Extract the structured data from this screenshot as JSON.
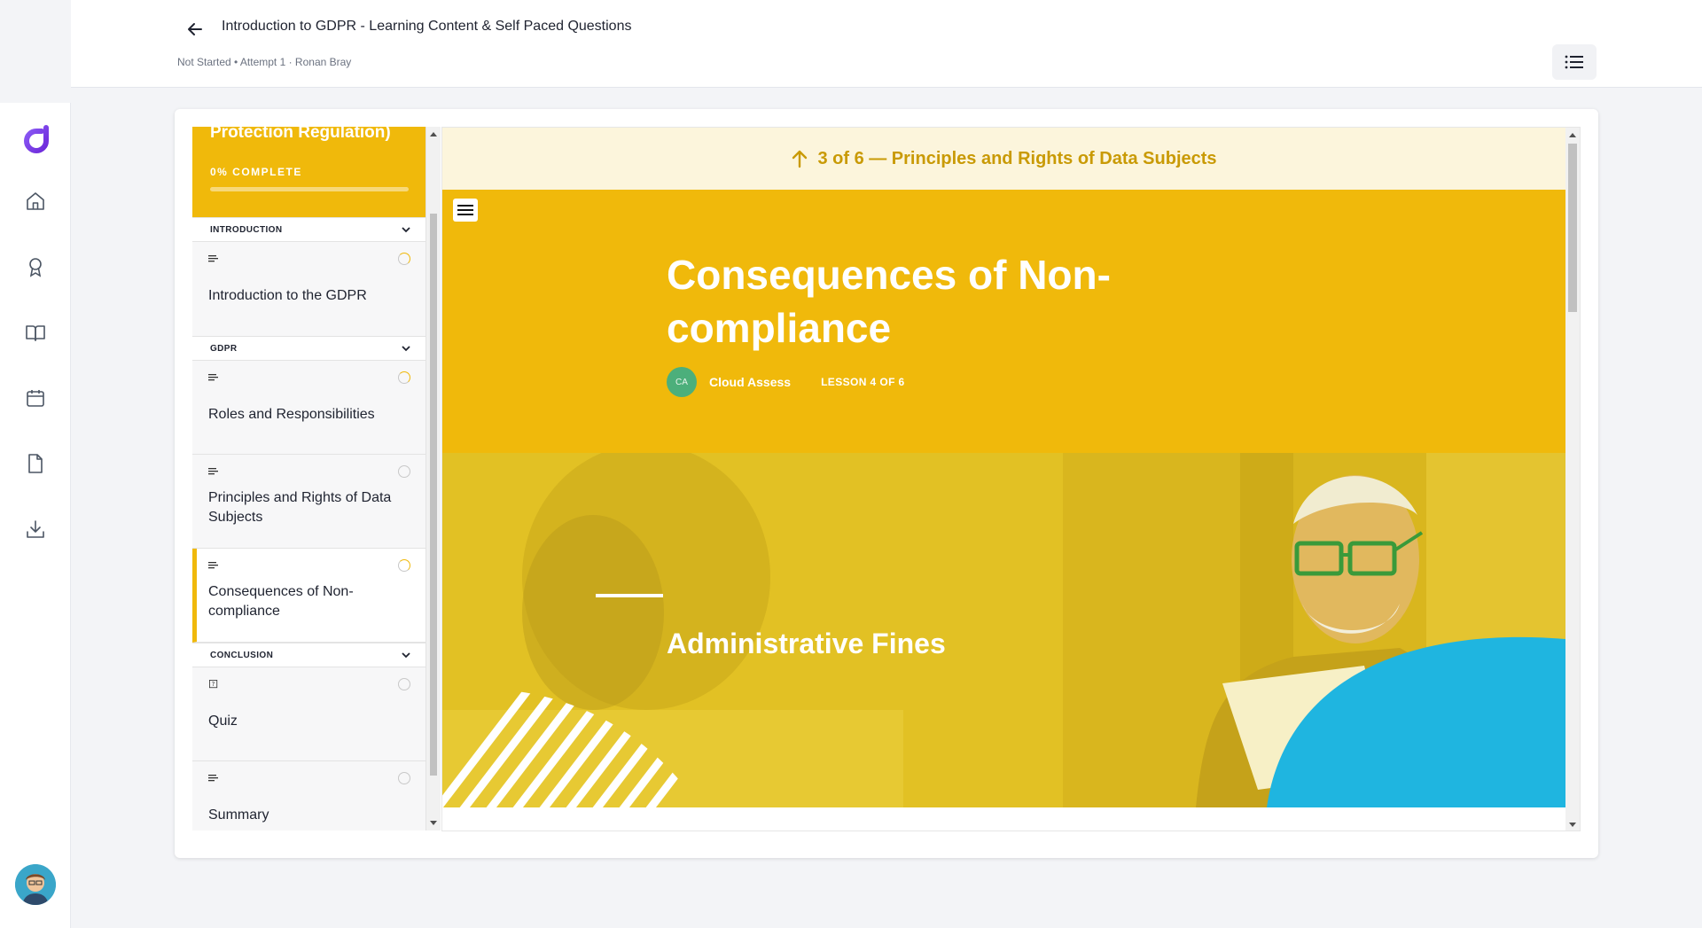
{
  "header": {
    "title": "Introduction to GDPR - Learning Content & Self Paced Questions",
    "meta": "Not Started • Attempt 1 · Ronan Bray"
  },
  "rail": {
    "items": [
      "logo-icon",
      "home-icon",
      "award-icon",
      "book-icon",
      "calendar-icon",
      "document-icon",
      "download-icon"
    ]
  },
  "course": {
    "title_fragment": "Protection Regulation)",
    "progress_label": "0% COMPLETE",
    "progress": 0,
    "accent_color": "#f0b90b",
    "sections": [
      {
        "label": "INTRODUCTION"
      },
      {
        "label": "GDPR"
      },
      {
        "label": "CONCLUSION"
      }
    ],
    "lessons": [
      {
        "title": "Introduction to the GDPR",
        "status": "started"
      },
      {
        "title": "Roles and Responsibilities",
        "status": "started"
      },
      {
        "title": "Principles and Rights of Data Subjects",
        "status": "not-started"
      },
      {
        "title": "Consequences of Non-compliance",
        "status": "started",
        "active": true
      },
      {
        "title": "Quiz",
        "status": "not-started"
      },
      {
        "title": "Summary",
        "status": "not-started"
      }
    ]
  },
  "content": {
    "prev_lesson": "3 of 6 — Principles and Rights of Data Subjects",
    "lesson_title": "Consequences of Non-compliance",
    "author_initials": "CA",
    "author": "Cloud Assess",
    "lesson_count": "LESSON 4 OF 6",
    "banner_title": "Administrative Fines"
  }
}
